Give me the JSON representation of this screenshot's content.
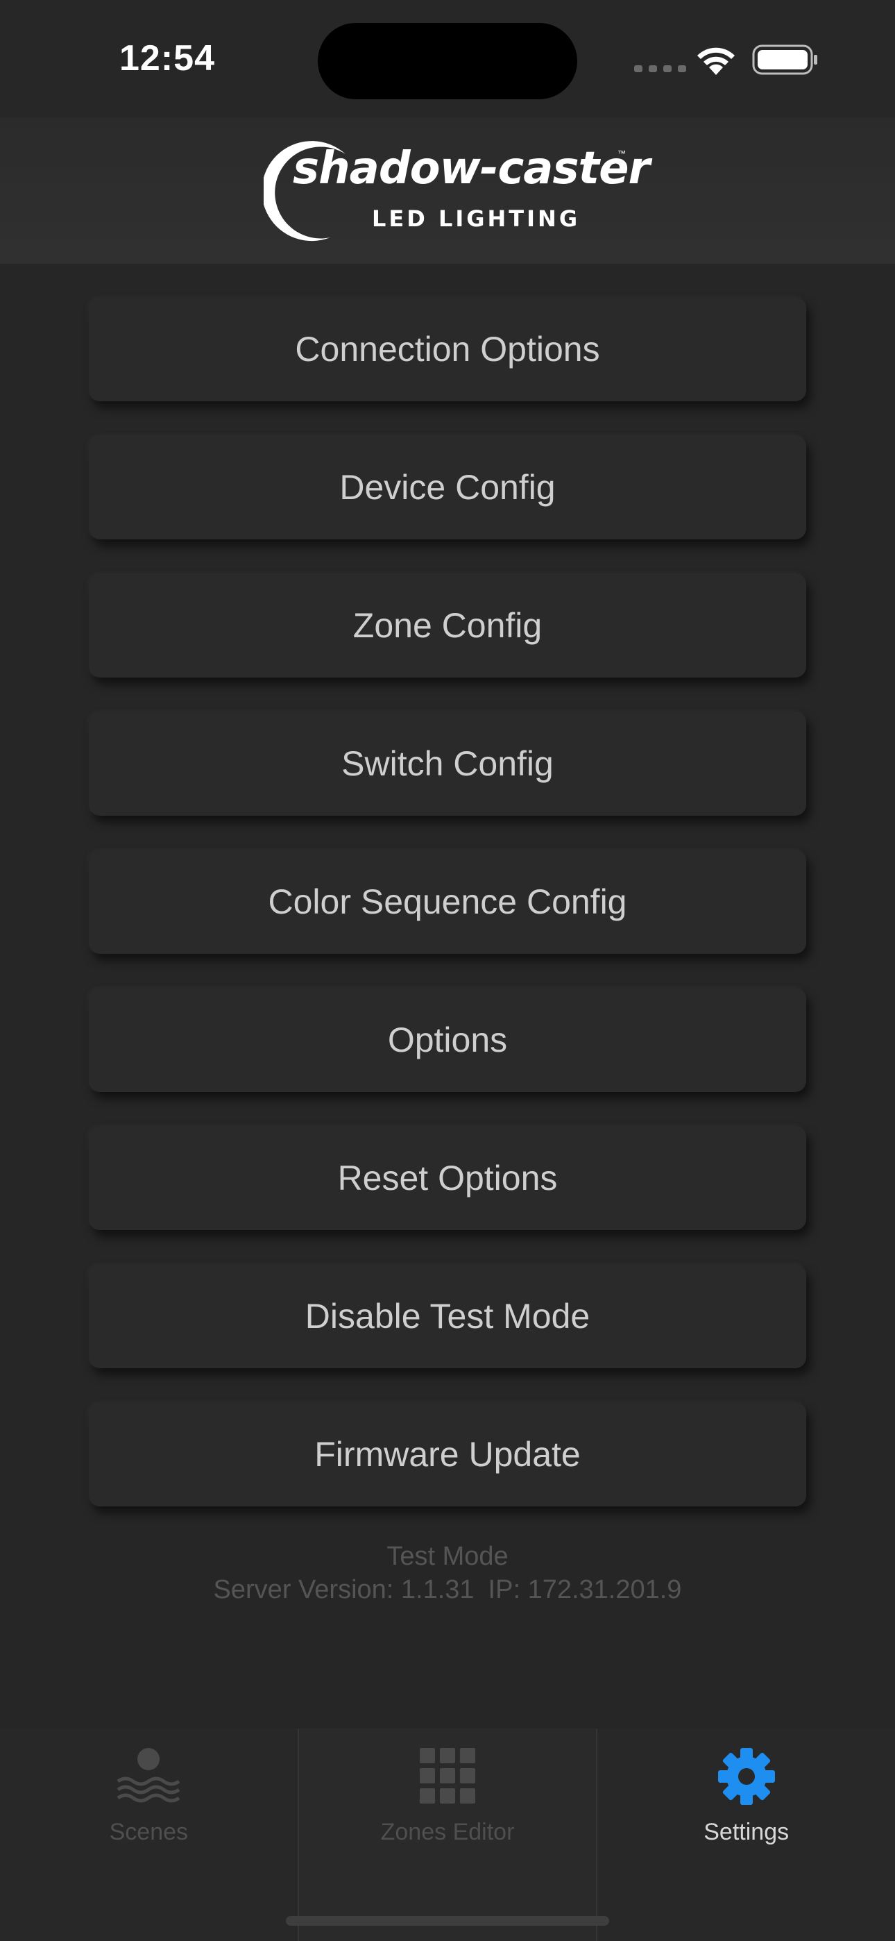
{
  "status_bar": {
    "time": "12:54"
  },
  "header": {
    "logo_word": "shadow-caster",
    "logo_tm": "™",
    "logo_sub": "LED LIGHTING"
  },
  "menu": [
    {
      "label": "Connection Options"
    },
    {
      "label": "Device Config"
    },
    {
      "label": "Zone Config"
    },
    {
      "label": "Switch Config"
    },
    {
      "label": "Color Sequence Config"
    },
    {
      "label": "Options"
    },
    {
      "label": "Reset Options"
    },
    {
      "label": "Disable Test Mode"
    },
    {
      "label": "Firmware Update"
    }
  ],
  "info": {
    "mode": "Test Mode",
    "server_version": "Server Version: 1.1.31",
    "ip": "IP: 172.31.201.9"
  },
  "tabbar": {
    "tabs": [
      {
        "label": "Scenes",
        "icon": "scenes-icon"
      },
      {
        "label": "Zones Editor",
        "icon": "grid-icon"
      },
      {
        "label": "Settings",
        "icon": "gear-icon",
        "active": true
      }
    ],
    "accent_color": "#1e8ef0"
  }
}
